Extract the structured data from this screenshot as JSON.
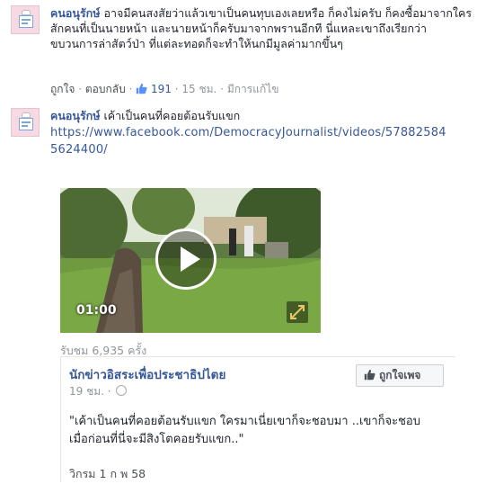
{
  "comment1": {
    "author": "คนอนุรักษ์",
    "text": "อาจมีคนสงสัยว่าแล้วเขาเป็นคนทุบเองเลยหรือ ก็คงไม่ครับ ก็คงซื้อมาจากใครสักคนที่เป็นนายหน้า และนายหน้าก็ครับมาจากพรานอีกที นี่แหละเขาถึงเรียกว่าขบวนการล่าสัตว์ป่า ที่แต่ละทอดก็จะทำให้นกมีมูลค่ามากขึ้นๆ",
    "like_label": "ถูกใจ",
    "reply_label": "ตอบกลับ",
    "like_count": "191",
    "time": "15 ชม.",
    "edited": "มีการแก้ไข"
  },
  "comment2": {
    "author": "คนอนุรักษ์",
    "text": "เค้าเป็นคนที่คอยต้อนรับแขก",
    "url_line1": "https://www.facebook.com/DemocracyJournalist/videos/57882584",
    "url_line2": "5624400/"
  },
  "video": {
    "duration": "01:00",
    "views": "รับชม 6,935 ครั้ง",
    "icons": [
      "play-icon",
      "expand-icon"
    ]
  },
  "embed": {
    "page_name": "นักข่าวอิสระเพื่อประชาธิปไตย",
    "time": "19 ชม.",
    "like_page_label": "ถูกใจเพจ",
    "quote_line1": "\"เค้าเป็นคนที่คอยต้อนรับแขก ใครมาเนี่ยเขาก็จะชอบมา ..เขาก็จะชอบ",
    "quote_line2": "เมื่อก่อนที่นี่จะมีสิงโตคอยรับแขก..\"",
    "date": "วิกรม 1 ก พ 58"
  },
  "colors": {
    "link": "#365899",
    "meta": "#90949c",
    "text": "#1d2129"
  }
}
